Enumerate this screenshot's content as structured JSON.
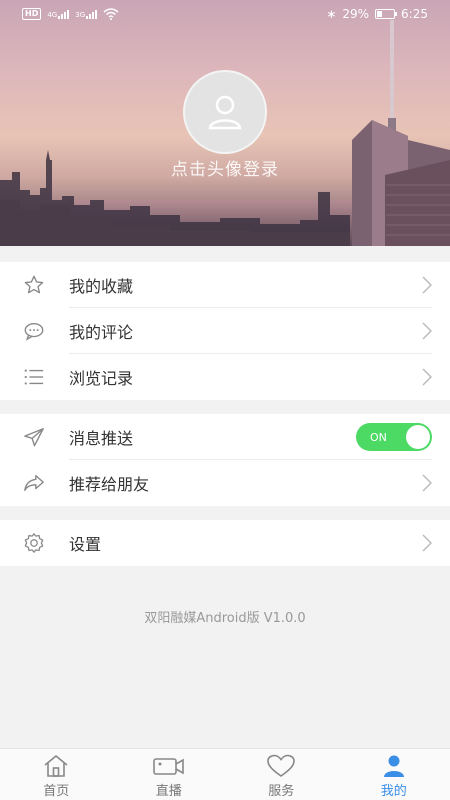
{
  "status_bar": {
    "left_badges": [
      "HD",
      "4G",
      "3G"
    ],
    "battery": "29%",
    "time": "6:25",
    "icons": [
      "hd-icon",
      "signal-icon",
      "wifi-icon",
      "bluetooth-icon",
      "battery-icon"
    ]
  },
  "profile": {
    "login_prompt": "点击头像登录",
    "avatar_icon": "user-placeholder-icon"
  },
  "menu_group_1": [
    {
      "label": "我的收藏",
      "icon": "star-icon"
    },
    {
      "label": "我的评论",
      "icon": "comment-icon"
    },
    {
      "label": "浏览记录",
      "icon": "list-icon"
    }
  ],
  "menu_group_2": {
    "push": {
      "label": "消息推送",
      "icon": "send-icon",
      "toggle_text": "ON",
      "enabled": true
    },
    "share": {
      "label": "推荐给朋友",
      "icon": "share-icon"
    }
  },
  "menu_group_3": [
    {
      "label": "设置",
      "icon": "gear-icon"
    }
  ],
  "version_text": "双阳融媒Android版 V1.0.0",
  "bottom_nav": [
    {
      "label": "首页",
      "icon": "home-icon",
      "active": false
    },
    {
      "label": "直播",
      "icon": "video-camera-icon",
      "active": false
    },
    {
      "label": "服务",
      "icon": "heart-icon",
      "active": false
    },
    {
      "label": "我的",
      "icon": "person-icon",
      "active": true
    }
  ],
  "colors": {
    "accent": "#3a8ee6",
    "toggle_on": "#4cd964",
    "background": "#f2f2f2"
  }
}
